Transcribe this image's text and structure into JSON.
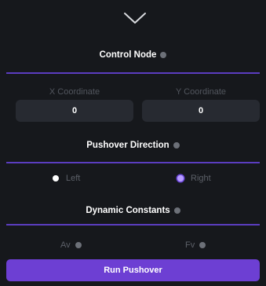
{
  "header": {
    "collapse_icon": "chevron-down-icon"
  },
  "control_node": {
    "title": "Control Node",
    "x_label": "X Coordinate",
    "x_value": "0",
    "y_label": "Y Coordinate",
    "y_value": "0"
  },
  "pushover_direction": {
    "title": "Pushover Direction",
    "options": [
      {
        "label": "Left",
        "selected": false
      },
      {
        "label": "Right",
        "selected": true
      }
    ]
  },
  "dynamic_constants": {
    "title": "Dynamic Constants",
    "av_label": "Av",
    "fv_label": "Fv"
  },
  "actions": {
    "run_label": "Run Pushover"
  },
  "colors": {
    "background": "#16181c",
    "accent": "#6d3fd3",
    "divider": "#5b3dc0",
    "input_bg": "#272a31",
    "muted_text": "#5c6068"
  }
}
